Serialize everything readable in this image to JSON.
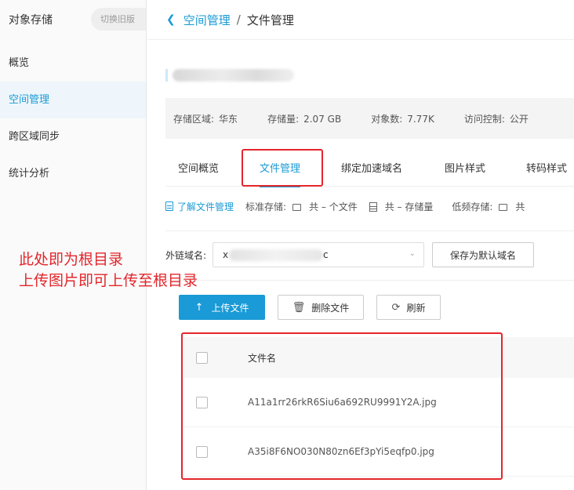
{
  "sidebar": {
    "title": "对象存储",
    "switch_label": "切换旧版",
    "items": [
      {
        "label": "概览"
      },
      {
        "label": "空间管理"
      },
      {
        "label": "跨区域同步"
      },
      {
        "label": "统计分析"
      }
    ],
    "active_index": 1
  },
  "breadcrumb": {
    "back_icon": "chevron-left-icon",
    "parent": "空间管理",
    "separator": "/",
    "current": "文件管理"
  },
  "info": {
    "region_label": "存储区域:",
    "region_value": "华东",
    "storage_label": "存储量:",
    "storage_value": "2.07 GB",
    "objects_label": "对象数:",
    "objects_value": "7.77K",
    "access_label": "访问控制:",
    "access_value": "公开"
  },
  "tabs": [
    {
      "label": "空间概览"
    },
    {
      "label": "文件管理"
    },
    {
      "label": "绑定加速域名"
    },
    {
      "label": "图片样式"
    },
    {
      "label": "转码样式"
    }
  ],
  "active_tab": 1,
  "stats": {
    "learn_link": "了解文件管理",
    "standard_label": "标准存储:",
    "standard_files": "共 – 个文件",
    "standard_size": "共 – 存储量",
    "infrequent_label": "低频存储:",
    "infrequent_files": "共"
  },
  "domain": {
    "label": "外链域名:",
    "value_prefix": "x",
    "value_suffix": "c",
    "save_default_label": "保存为默认域名"
  },
  "actions": {
    "upload_label": "上传文件",
    "delete_label": "删除文件",
    "refresh_label": "刷新"
  },
  "table": {
    "header": "文件名",
    "rows": [
      {
        "name": "A11a1rr26rkR6Siu6a692RU9991Y2A.jpg"
      },
      {
        "name": "A35i8F6NO030N80zn6Ef3pYi5eqfp0.jpg"
      }
    ]
  },
  "annotation": {
    "line1": "此处即为根目录",
    "line2": "上传图片即可上传至根目录"
  },
  "colors": {
    "accent": "#1a9ad6",
    "annotation_red": "#e3262b"
  }
}
